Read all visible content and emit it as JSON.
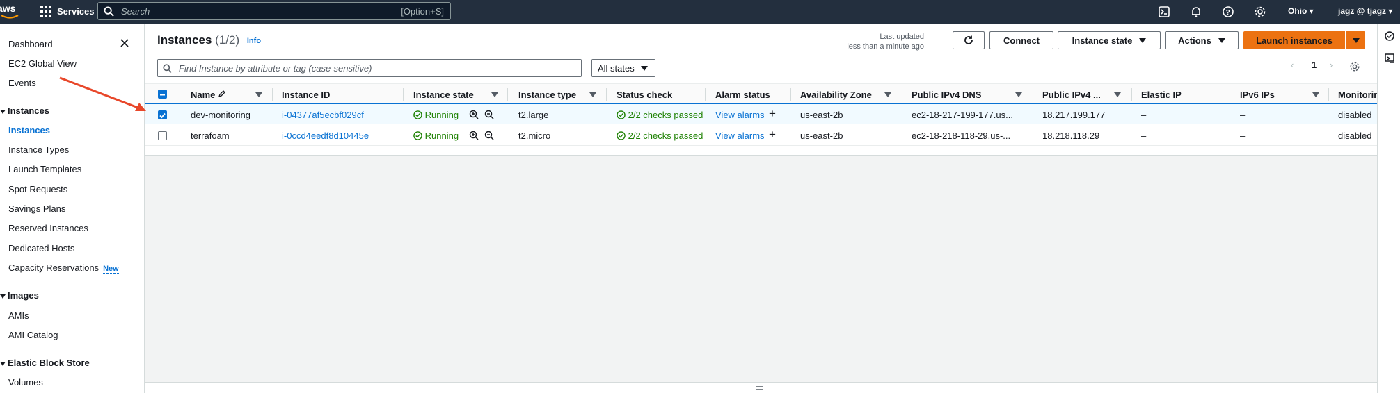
{
  "topbar": {
    "services_label": "Services",
    "search_placeholder": "Search",
    "search_shortcut": "[Option+S]",
    "region": "Ohio",
    "user": "jagz @ tjagz"
  },
  "sidebar": {
    "top_items": [
      "Dashboard",
      "EC2 Global View",
      "Events"
    ],
    "instances_section": "Instances",
    "instances_items": [
      "Instances",
      "Instance Types",
      "Launch Templates",
      "Spot Requests",
      "Savings Plans",
      "Reserved Instances",
      "Dedicated Hosts",
      "Capacity Reservations"
    ],
    "new_badge": "New",
    "images_section": "Images",
    "images_items": [
      "AMIs",
      "AMI Catalog"
    ],
    "ebs_section": "Elastic Block Store",
    "ebs_items": [
      "Volumes"
    ]
  },
  "header": {
    "title": "Instances",
    "count": "(1/2)",
    "info": "Info",
    "last_updated_line1": "Last updated",
    "last_updated_line2": "less than a minute ago",
    "connect": "Connect",
    "instance_state": "Instance state",
    "actions": "Actions",
    "launch": "Launch instances"
  },
  "filter": {
    "placeholder": "Find Instance by attribute or tag (case-sensitive)",
    "states": "All states",
    "page": "1"
  },
  "table": {
    "columns": [
      "Name",
      "Instance ID",
      "Instance state",
      "Instance type",
      "Status check",
      "Alarm status",
      "Availability Zone",
      "Public IPv4 DNS",
      "Public IPv4 ...",
      "Elastic IP",
      "IPv6 IPs",
      "Monitoring"
    ],
    "rows": [
      {
        "name": "dev-monitoring",
        "id": "i-04377af5ecbf029cf",
        "state": "Running",
        "type": "t2.large",
        "status": "2/2 checks passed",
        "alarm": "View alarms",
        "az": "us-east-2b",
        "dns": "ec2-18-217-199-177.us...",
        "ip": "18.217.199.177",
        "eip": "–",
        "ipv6": "–",
        "monitoring": "disabled",
        "selected": true
      },
      {
        "name": "terrafoam",
        "id": "i-0ccd4eedf8d10445e",
        "state": "Running",
        "type": "t2.micro",
        "status": "2/2 checks passed",
        "alarm": "View alarms",
        "az": "us-east-2b",
        "dns": "ec2-18-218-118-29.us-...",
        "ip": "18.218.118.29",
        "eip": "–",
        "ipv6": "–",
        "monitoring": "disabled",
        "selected": false
      }
    ]
  },
  "colors": {
    "topbar": "#232f3e",
    "accent": "#0972d3",
    "primary_button": "#ec7211",
    "success": "#1d8102",
    "annotation_arrow": "#e8472a"
  }
}
